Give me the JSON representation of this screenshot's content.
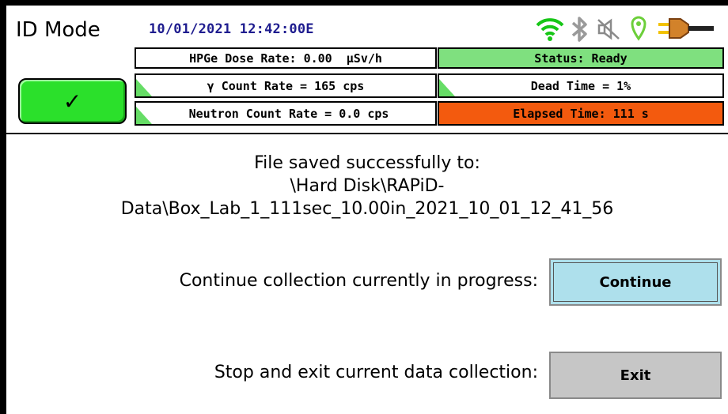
{
  "header": {
    "mode_title": "ID Mode",
    "datetime": "10/01/2021 12:42:00E"
  },
  "status_icons": [
    "wifi-icon",
    "bluetooth-icon",
    "sound-muted-icon",
    "location-pin-icon",
    "power-plug-icon"
  ],
  "metrics": {
    "dose_rate": "HPGe Dose Rate: 0.00  µSv/h",
    "gamma_rate": "γ Count Rate = 165 cps",
    "neutron_rate": "Neutron Count Rate = 0.0 cps",
    "status": "Status: Ready",
    "dead_time": "Dead Time = 1%",
    "elapsed_time": "Elapsed Time: 111 s"
  },
  "ok_button": {
    "symbol": "✓"
  },
  "message": {
    "line1": "File saved successfully to:",
    "line2": "\\Hard Disk\\RAPiD-",
    "line3": "Data\\Box_Lab_1_111sec_10.00in_2021_10_01_12_41_56"
  },
  "actions": {
    "continue_label": "Continue collection currently in progress:",
    "continue_button": "Continue",
    "exit_label": "Stop and exit current data collection:",
    "exit_button": "Exit"
  },
  "colors": {
    "status_ready": "#7fe07f",
    "elapsed": "#f35a0e",
    "ok_button": "#2be02b",
    "continue_button": "#aee0ec",
    "exit_button": "#c6c6c6",
    "datetime_text": "#1f1d8f"
  }
}
